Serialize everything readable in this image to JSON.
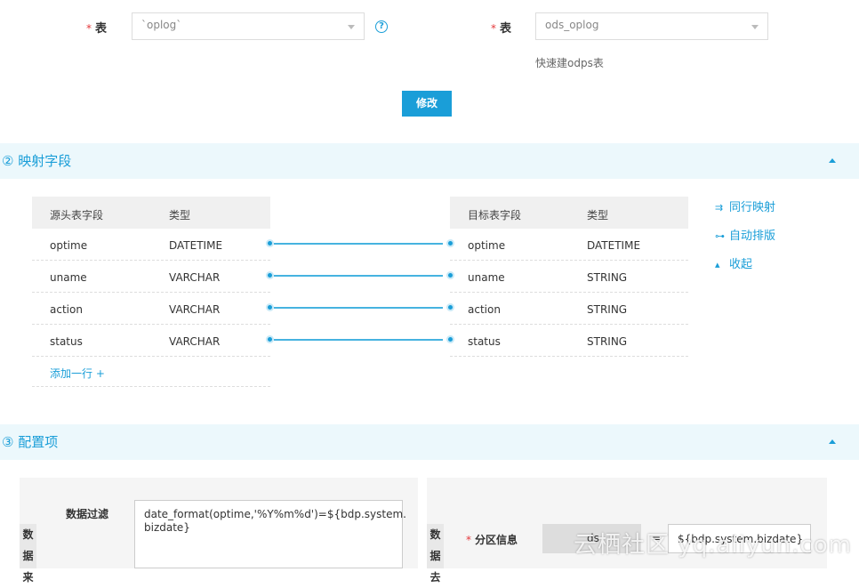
{
  "top": {
    "src_label": "表",
    "src_value": "`oplog`",
    "dst_label": "表",
    "dst_value": "ods_oplog",
    "help": "?",
    "quick_link": "快速建odps表",
    "modify_btn": "修改"
  },
  "section2": {
    "title": "② 映射字段"
  },
  "source_table": {
    "headers": [
      "源头表字段",
      "类型"
    ],
    "rows": [
      {
        "name": "optime",
        "type": "DATETIME"
      },
      {
        "name": "uname",
        "type": "VARCHAR"
      },
      {
        "name": "action",
        "type": "VARCHAR"
      },
      {
        "name": "status",
        "type": "VARCHAR"
      }
    ],
    "add_row": "添加一行 +"
  },
  "target_table": {
    "headers": [
      "目标表字段",
      "类型"
    ],
    "rows": [
      {
        "name": "optime",
        "type": "DATETIME"
      },
      {
        "name": "uname",
        "type": "STRING"
      },
      {
        "name": "action",
        "type": "STRING"
      },
      {
        "name": "status",
        "type": "STRING"
      }
    ]
  },
  "side_actions": {
    "same_row": "同行映射",
    "auto_layout": "自动排版",
    "collapse": "收起"
  },
  "section3": {
    "title": "③ 配置项"
  },
  "config": {
    "left_vtab": [
      "数",
      "据",
      "来"
    ],
    "filter_label": "数据过滤",
    "filter_value_1": "date_format(optime,'%Y%m%d')=${bdp.system.",
    "filter_value_2": "bizdate}",
    "right_vtab": [
      "数",
      "据",
      "去"
    ],
    "partition_label": "分区信息",
    "partition_key": "ds",
    "equals": "=",
    "partition_value": "${bdp.system.bizdate}"
  },
  "watermark": "云栖社区 yq.aliyun.com",
  "colors": {
    "accent": "#1a9ed8",
    "required": "#e4393c",
    "section_bg": "#ecf8fc"
  }
}
